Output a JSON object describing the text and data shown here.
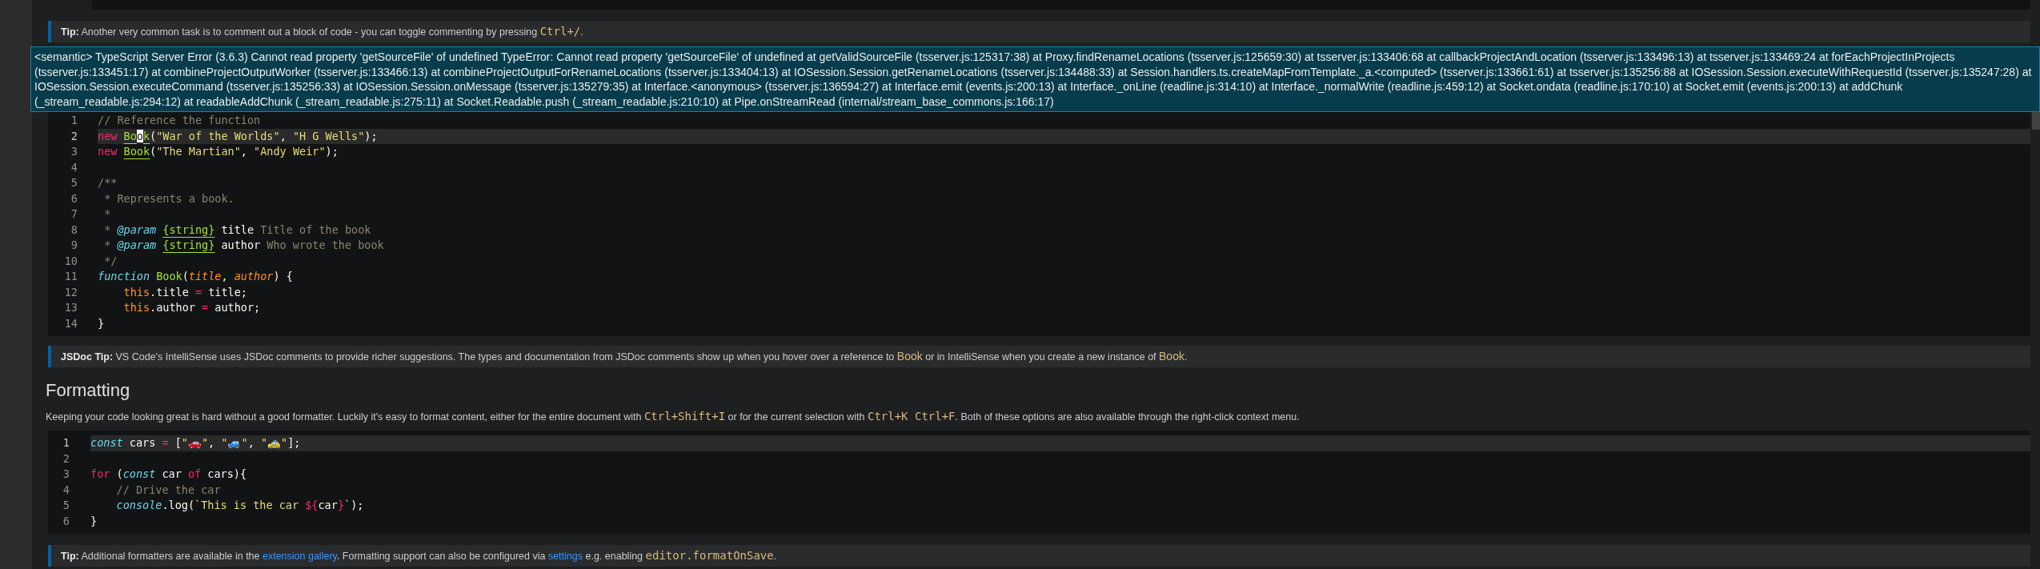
{
  "tip_top": {
    "segments": [
      {
        "kind": "bold",
        "text": "Tip:"
      },
      {
        "kind": "text",
        "text": " Another very common task is to comment out a block of code - you can toggle commenting by pressing "
      },
      {
        "kind": "code",
        "text": "Ctrl+/"
      },
      {
        "kind": "text",
        "text": "."
      }
    ]
  },
  "error_popup": {
    "text": "<semantic> TypeScript Server Error (3.6.3) Cannot read property 'getSourceFile' of undefined TypeError: Cannot read property 'getSourceFile' of undefined at getValidSourceFile (tsserver.js:125317:38) at Proxy.findRenameLocations (tsserver.js:125659:30) at tsserver.js:133406:68 at callbackProjectAndLocation (tsserver.js:133496:13) at tsserver.js:133469:24 at forEachProjectInProjects (tsserver.js:133451:17) at combineProjectOutputWorker (tsserver.js:133466:13) at combineProjectOutputForRenameLocations (tsserver.js:133404:13) at IOSession.Session.getRenameLocations (tsserver.js:134488:33) at Session.handlers.ts.createMapFromTemplate._a.<computed> (tsserver.js:133661:61) at tsserver.js:135256:88 at IOSession.Session.executeWithRequestId (tsserver.js:135247:28) at IOSession.Session.executeCommand (tsserver.js:135256:33) at IOSession.Session.onMessage (tsserver.js:135279:35) at Interface.<anonymous> (tsserver.js:136594:27) at Interface.emit (events.js:200:13) at Interface._onLine (readline.js:314:10) at Interface._normalWrite (readline.js:459:12) at Socket.ondata (readline.js:170:10) at Socket.emit (events.js:200:13) at addChunk (_stream_readable.js:294:12) at readableAddChunk (_stream_readable.js:275:11) at Socket.Readable.push (_stream_readable.js:210:10) at Pipe.onStreamRead (internal/stream_base_commons.js:166:17)"
  },
  "code_block_1": {
    "lines": [
      {
        "number": "1",
        "current": false,
        "indent": false,
        "tokens": [
          {
            "kind": "comment",
            "text": "// Reference the function"
          }
        ]
      },
      {
        "number": "2",
        "current": true,
        "indent": false,
        "tokens": [
          {
            "kind": "keyword",
            "text": "new "
          },
          {
            "kind": "class",
            "text": "Bo"
          },
          {
            "kind": "cursor",
            "text": "o"
          },
          {
            "kind": "class",
            "text": "k"
          },
          {
            "kind": "plain",
            "text": "("
          },
          {
            "kind": "string",
            "text": "\"War of the Worlds\""
          },
          {
            "kind": "plain",
            "text": ", "
          },
          {
            "kind": "string",
            "text": "\"H G Wells\""
          },
          {
            "kind": "plain",
            "text": ");"
          }
        ]
      },
      {
        "number": "3",
        "current": false,
        "indent": false,
        "tokens": [
          {
            "kind": "keyword",
            "text": "new "
          },
          {
            "kind": "class",
            "text": "Book"
          },
          {
            "kind": "plain",
            "text": "("
          },
          {
            "kind": "string",
            "text": "\"The Martian\""
          },
          {
            "kind": "plain",
            "text": ", "
          },
          {
            "kind": "string",
            "text": "\"Andy Weir\""
          },
          {
            "kind": "plain",
            "text": ");"
          }
        ]
      },
      {
        "number": "4",
        "current": false
      },
      {
        "number": "5",
        "current": false,
        "indent": false,
        "tokens": [
          {
            "kind": "comment",
            "text": "/**"
          }
        ]
      },
      {
        "number": "6",
        "current": false,
        "indent": false,
        "tokens": [
          {
            "kind": "comment",
            "text": " * Represents a book."
          }
        ]
      },
      {
        "number": "7",
        "current": false,
        "indent": false,
        "tokens": [
          {
            "kind": "comment",
            "text": " *"
          }
        ]
      },
      {
        "number": "8",
        "current": false,
        "indent": false,
        "tokens": [
          {
            "kind": "comment",
            "text": " * "
          },
          {
            "kind": "tag",
            "text": "@param "
          },
          {
            "kind": "type",
            "text": "{string}"
          },
          {
            "kind": "plain",
            "text": " title"
          },
          {
            "kind": "comment",
            "text": " Title of the book"
          }
        ]
      },
      {
        "number": "9",
        "current": false,
        "indent": false,
        "tokens": [
          {
            "kind": "comment",
            "text": " * "
          },
          {
            "kind": "tag",
            "text": "@param "
          },
          {
            "kind": "type",
            "text": "{string}"
          },
          {
            "kind": "plain",
            "text": " author"
          },
          {
            "kind": "comment",
            "text": " Who wrote the book"
          }
        ]
      },
      {
        "number": "10",
        "current": false,
        "indent": false,
        "tokens": [
          {
            "kind": "comment",
            "text": " */"
          }
        ]
      },
      {
        "number": "11",
        "current": false,
        "indent": false,
        "tokens": [
          {
            "kind": "storage",
            "text": "function "
          },
          {
            "kind": "function",
            "text": "Book"
          },
          {
            "kind": "plain",
            "text": "("
          },
          {
            "kind": "param",
            "text": "title"
          },
          {
            "kind": "plain",
            "text": ", "
          },
          {
            "kind": "param",
            "text": "author"
          },
          {
            "kind": "plain",
            "text": ") {"
          }
        ]
      },
      {
        "number": "12",
        "current": false,
        "indent": true,
        "tokens": [
          {
            "kind": "this",
            "text": "this"
          },
          {
            "kind": "plain",
            "text": ".title "
          },
          {
            "kind": "keyword",
            "text": "="
          },
          {
            "kind": "plain",
            "text": " title;"
          }
        ]
      },
      {
        "number": "13",
        "current": false,
        "indent": true,
        "tokens": [
          {
            "kind": "this",
            "text": "this"
          },
          {
            "kind": "plain",
            "text": ".author "
          },
          {
            "kind": "keyword",
            "text": "="
          },
          {
            "kind": "plain",
            "text": " author;"
          }
        ]
      },
      {
        "number": "14",
        "current": false,
        "indent": false,
        "tokens": [
          {
            "kind": "plain",
            "text": "}"
          }
        ]
      }
    ]
  },
  "tip_jsdoc": {
    "segments": [
      {
        "kind": "bold",
        "text": "JSDoc Tip:"
      },
      {
        "kind": "text",
        "text": " VS Code's IntelliSense uses JSDoc comments to provide richer suggestions. The types and documentation from JSDoc comments show up when you hover over a reference to "
      },
      {
        "kind": "ref",
        "text": "Book"
      },
      {
        "kind": "text",
        "text": " or in IntelliSense when you create a new instance of "
      },
      {
        "kind": "ref",
        "text": "Book"
      },
      {
        "kind": "text",
        "text": "."
      }
    ]
  },
  "formatting": {
    "heading": "Formatting",
    "paragraph": [
      {
        "kind": "text",
        "text": "Keeping your code looking great is hard without a good formatter. Luckily it's easy to format content, either for the entire document with "
      },
      {
        "kind": "code",
        "text": "Ctrl+Shift+I"
      },
      {
        "kind": "text",
        "text": " or for the current selection with "
      },
      {
        "kind": "code",
        "text": "Ctrl+K Ctrl+F"
      },
      {
        "kind": "text",
        "text": ". Both of these options are also available through the right-click context menu."
      }
    ]
  },
  "code_block_2": {
    "lines": [
      {
        "number": "1",
        "current": true,
        "indent": false,
        "tokens": [
          {
            "kind": "storage",
            "text": "const"
          },
          {
            "kind": "plain",
            "text": " cars "
          },
          {
            "kind": "keyword",
            "text": "="
          },
          {
            "kind": "plain",
            "text": " ["
          },
          {
            "kind": "string",
            "text": "\"🚗\""
          },
          {
            "kind": "plain",
            "text": ", "
          },
          {
            "kind": "string",
            "text": "\"🚙\""
          },
          {
            "kind": "plain",
            "text": ", "
          },
          {
            "kind": "string",
            "text": "\"🚕\""
          },
          {
            "kind": "plain",
            "text": "];"
          }
        ]
      },
      {
        "number": "2",
        "current": false
      },
      {
        "number": "3",
        "current": false,
        "indent": false,
        "tokens": [
          {
            "kind": "keyword",
            "text": "for"
          },
          {
            "kind": "plain",
            "text": " ("
          },
          {
            "kind": "storage",
            "text": "const"
          },
          {
            "kind": "plain",
            "text": " car "
          },
          {
            "kind": "keyword",
            "text": "of"
          },
          {
            "kind": "plain",
            "text": " cars){"
          }
        ]
      },
      {
        "number": "4",
        "current": false,
        "indent": true,
        "tokens": [
          {
            "kind": "comment",
            "text": "// Drive the car"
          }
        ]
      },
      {
        "number": "5",
        "current": false,
        "indent": true,
        "tokens": [
          {
            "kind": "storage",
            "text": "console"
          },
          {
            "kind": "plain",
            "text": ".log("
          },
          {
            "kind": "string",
            "text": "`This is the car "
          },
          {
            "kind": "keyword",
            "text": "${"
          },
          {
            "kind": "plain",
            "text": "car"
          },
          {
            "kind": "keyword",
            "text": "}"
          },
          {
            "kind": "string",
            "text": "`"
          },
          {
            "kind": "plain",
            "text": ");"
          }
        ]
      },
      {
        "number": "6",
        "current": false,
        "indent": false,
        "tokens": [
          {
            "kind": "plain",
            "text": "}"
          }
        ]
      }
    ]
  },
  "tip_bottom": {
    "segments": [
      {
        "kind": "bold",
        "text": "Tip:"
      },
      {
        "kind": "text",
        "text": " Additional formatters are available in the "
      },
      {
        "kind": "link",
        "text": "extension gallery"
      },
      {
        "kind": "text",
        "text": ". Formatting support can also be configured via "
      },
      {
        "kind": "link",
        "text": "settings"
      },
      {
        "kind": "text",
        "text": " e.g. enabling "
      },
      {
        "kind": "code",
        "text": "editor.formatOnSave"
      },
      {
        "kind": "text",
        "text": "."
      }
    ]
  }
}
